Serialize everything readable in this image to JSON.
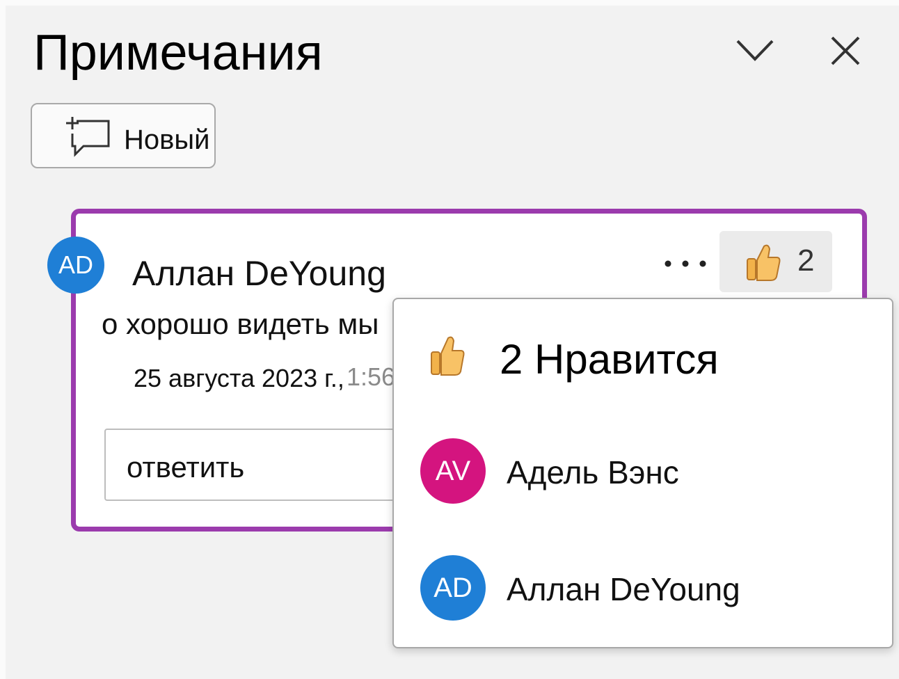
{
  "pane": {
    "title": "Примечания",
    "collapse_icon": "chevron-down-icon",
    "close_icon": "close-icon",
    "new_button_label": "Новый",
    "new_button_icon": "new-comment-icon"
  },
  "comment": {
    "avatar_initials": "AD",
    "author": "Аллан DeYoung",
    "text": "о хорошо видеть мы",
    "date": "25 августа 2023 г.,",
    "time": "1:56",
    "more_icon": "more-icon",
    "like_icon": "thumbs-up-icon",
    "like_count": "2",
    "reply_placeholder": "ответить",
    "accent_color": "#9b3bad"
  },
  "likes_popup": {
    "title": "2 Нравится",
    "users": [
      {
        "initials": "AV",
        "name": "Адель Вэнс",
        "color": "#d4147f"
      },
      {
        "initials": "AD",
        "name": "Аллан DeYoung",
        "color": "#1f7fd6"
      }
    ]
  }
}
